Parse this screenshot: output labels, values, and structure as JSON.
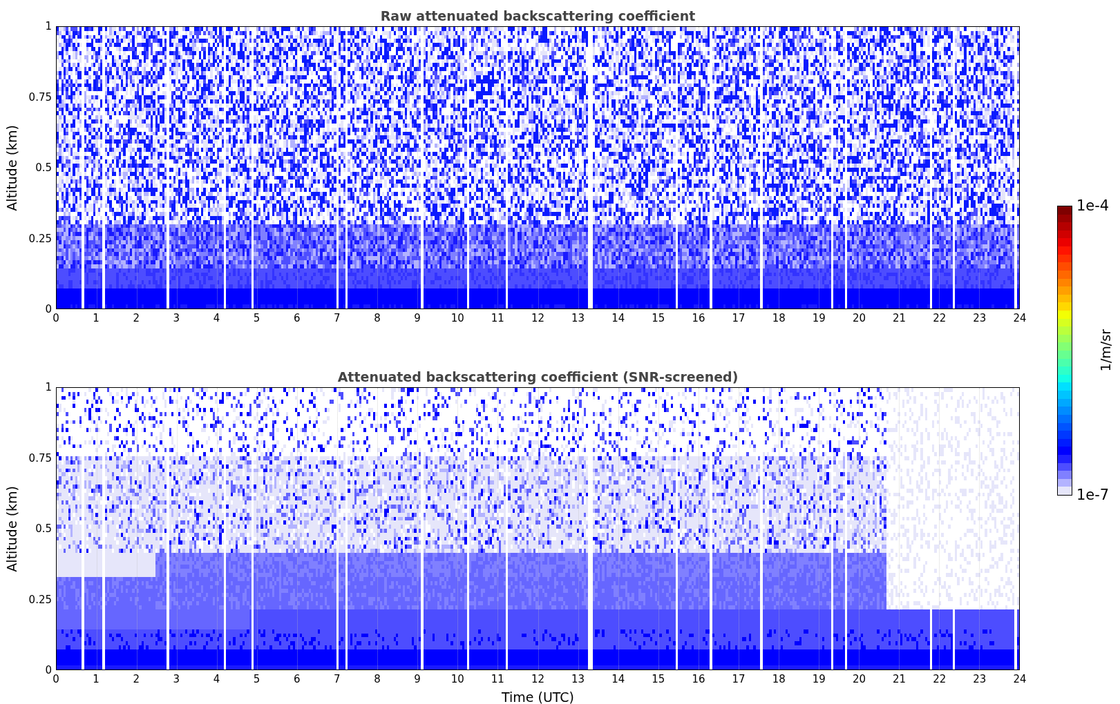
{
  "panels": [
    {
      "kind": "raw",
      "title": "Raw attenuated backscattering coefficient",
      "ylabel": "Altitude (km)",
      "yticks": [
        "1",
        "0.75",
        "0.5",
        "0.25",
        "0"
      ],
      "xticks": [
        "0",
        "1",
        "2",
        "3",
        "4",
        "5",
        "6",
        "7",
        "8",
        "9",
        "10",
        "11",
        "12",
        "13",
        "14",
        "15",
        "16",
        "17",
        "18",
        "19",
        "20",
        "21",
        "22",
        "23",
        "24"
      ]
    },
    {
      "kind": "screened",
      "title": "Attenuated backscattering coefficient (SNR-screened)",
      "ylabel": "Altitude (km)",
      "yticks": [
        "1",
        "0.75",
        "0.5",
        "0.25",
        "0"
      ],
      "xticks": [
        "0",
        "1",
        "2",
        "3",
        "4",
        "5",
        "6",
        "7",
        "8",
        "9",
        "10",
        "11",
        "12",
        "13",
        "14",
        "15",
        "16",
        "17",
        "18",
        "19",
        "20",
        "21",
        "22",
        "23",
        "24"
      ],
      "xlabel": "Time (UTC)"
    }
  ],
  "colorbar": {
    "max_label": "1e-4",
    "min_label": "1e-7",
    "unit": "1/m/sr"
  }
}
